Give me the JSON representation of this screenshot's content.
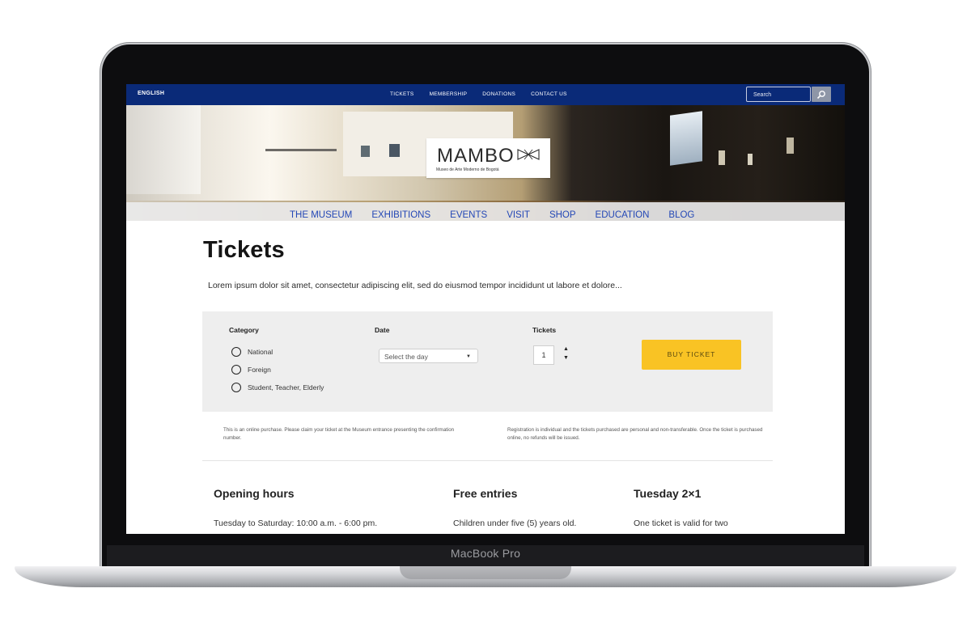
{
  "device": {
    "model_label": "MacBook Pro"
  },
  "topbar": {
    "language": "ENGLISH",
    "links": [
      "TICKETS",
      "MEMBERSHIP",
      "DONATIONS",
      "CONTACT US"
    ],
    "search_placeholder": "Search",
    "color": "#0a2a78"
  },
  "logo": {
    "name": "MAMBO",
    "subtitle": "Museo de Arte Moderno de Bogotá"
  },
  "main_nav": [
    "THE MUSEUM",
    "EXHIBITIONS",
    "EVENTS",
    "VISIT",
    "SHOP",
    "EDUCATION",
    "BLOG"
  ],
  "page": {
    "title": "Tickets",
    "lead": "Lorem ipsum dolor sit amet, consectetur adipiscing elit, sed do eiusmod tempor incididunt ut labore et dolore..."
  },
  "ticket_form": {
    "category_label": "Category",
    "categories": [
      "National",
      "Foreign",
      "Student, Teacher, Elderly"
    ],
    "date_label": "Date",
    "date_placeholder": "Select the day",
    "tickets_label": "Tickets",
    "tickets_value": "1",
    "buy_button": "BUY TICKET",
    "buy_color": "#f9c324"
  },
  "notes": {
    "left": "This is an online purchase. Please claim your ticket at the Museum entrance presenting the confirmation number.",
    "right": "Registration is individual and the tickets purchased are personal and non-transferable. Once the ticket is purchased online, no refunds will be issued."
  },
  "info": [
    {
      "heading": "Opening hours",
      "text": "Tuesday to Saturday: 10:00 a.m. - 6:00 pm."
    },
    {
      "heading": "Free entries",
      "text": "Children under five (5) years old."
    },
    {
      "heading": "Tuesday 2×1",
      "text": "One ticket is valid for two"
    }
  ],
  "icons": {
    "search": "magnifier-icon",
    "logo_mark": "bowtie-mark-icon"
  },
  "nav_link_color": "#2347b6"
}
